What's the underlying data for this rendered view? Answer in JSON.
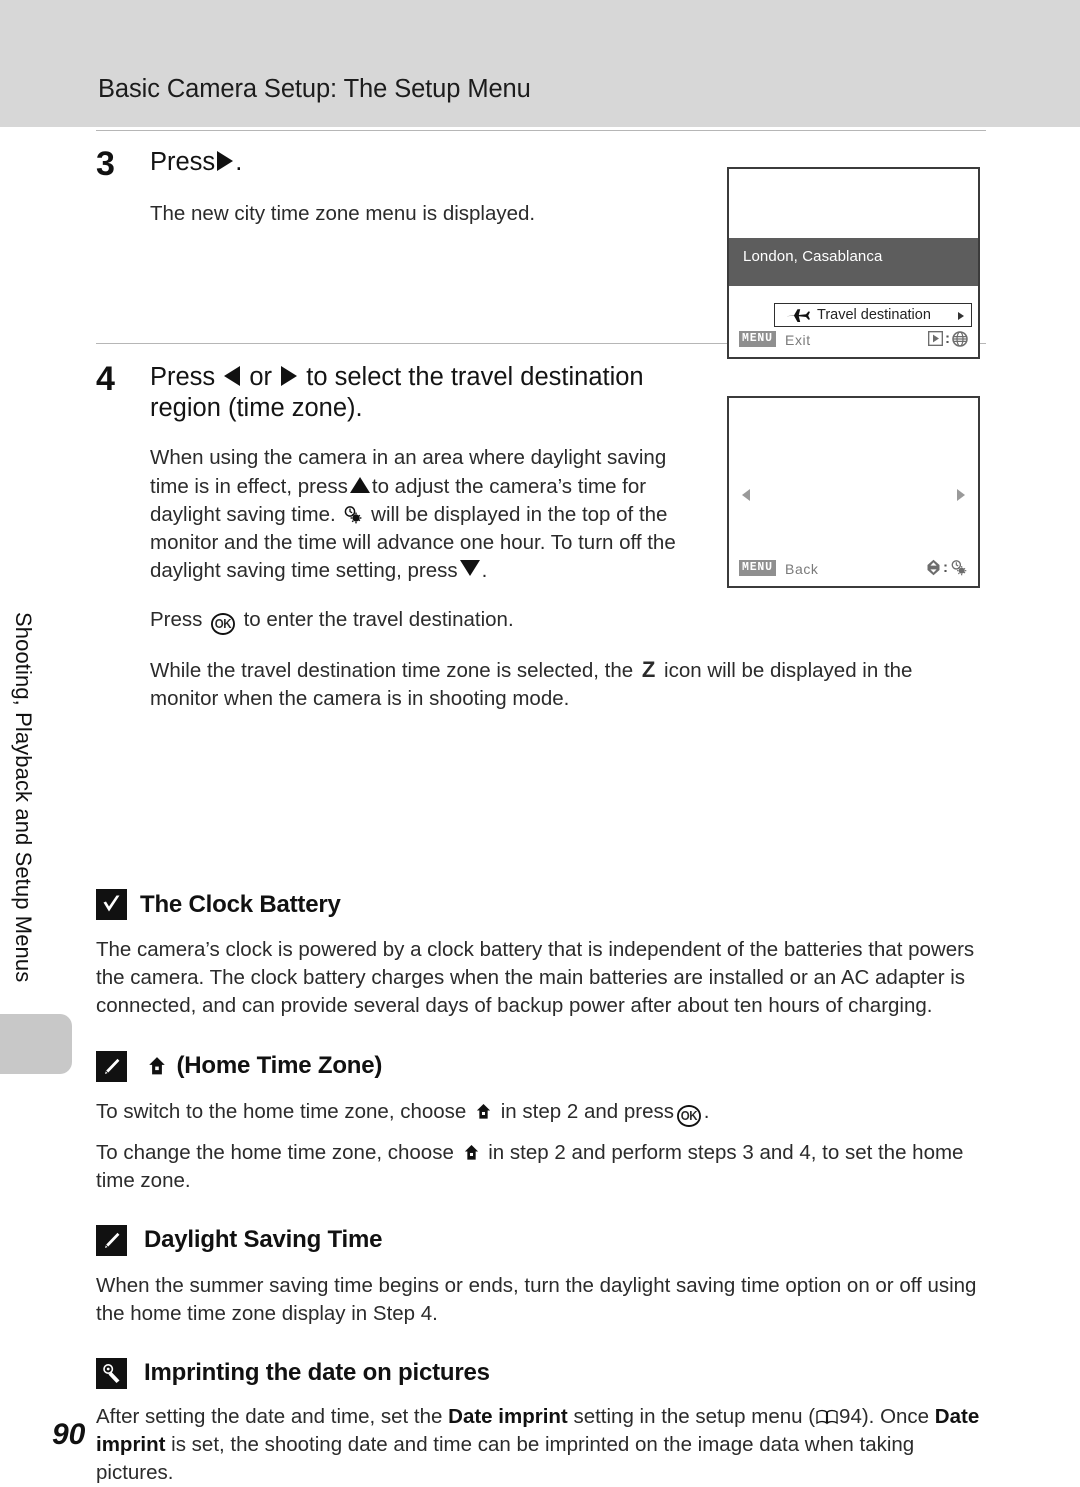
{
  "header": {
    "title": "Basic Camera Setup: The Setup Menu"
  },
  "sidebar": {
    "chapter_label": "Shooting, Playback and Setup Menus"
  },
  "page_number": "90",
  "steps": [
    {
      "number": "3",
      "heading_prefix": "Press",
      "heading_suffix": ".",
      "body": "The new city time zone menu is displayed."
    },
    {
      "number": "4",
      "heading_a": "Press",
      "heading_b": "or",
      "heading_c": "to select the travel destination region (time zone).",
      "p1_a": "When using the camera in an area where daylight saving time is in effect, press",
      "p1_b": "to adjust the camera’s time for daylight saving time.",
      "p1_c": "will be displayed in the top of the monitor and the time will advance one hour. To turn off the daylight saving time setting, press",
      "p1_d": ".",
      "p2_a": "Press",
      "p2_b": "to enter the travel destination.",
      "p3_a": "While the travel destination time zone is selected, the",
      "p3_z": "Z",
      "p3_b": "icon will be displayed in the monitor when the camera is in shooting mode."
    }
  ],
  "monitors": [
    {
      "id": "monitor-1",
      "city": "London, Casablanca",
      "row_label": "Travel destination",
      "menu_badge": "MENU",
      "menu_action": "Exit",
      "footer_icon_left": "playback-arrow-icon",
      "footer_icon_right": "globe-icon"
    },
    {
      "id": "monitor-2",
      "menu_badge": "MENU",
      "menu_action": "Back",
      "footer_icon_left": "up-down-arrow-icon",
      "footer_icon_right": "daylight-saving-icon"
    }
  ],
  "notes": [
    {
      "icon": "caution-checkbox-icon",
      "title": "The Clock Battery",
      "body": "The camera’s clock is powered by a clock battery that is independent of the batteries that powers the camera. The clock battery charges when the main batteries are installed or an AC adapter is connected, and can provide several days of backup power after about ten hours of charging."
    },
    {
      "icon": "pencil-note-icon",
      "title_suffix": "(Home Time Zone)",
      "line1_a": "To switch to the home time zone, choose",
      "line1_b": "in step 2 and press",
      "line1_c": ".",
      "line2_a": "To change the home time zone, choose",
      "line2_b": "in step 2 and perform steps 3 and 4, to set the home time zone."
    },
    {
      "icon": "pencil-note-icon",
      "title": "Daylight Saving Time",
      "body": "When the summer saving time begins or ends, turn the daylight saving time option on or off using the home time zone display in Step 4."
    },
    {
      "icon": "date-imprint-icon",
      "title": "Imprinting the date on pictures",
      "body_a": "After setting the date and time, set the",
      "bold_1": "Date imprint",
      "body_b": "setting in the setup menu (",
      "page_ref": "94",
      "body_c": "). Once",
      "bold_2": "Date imprint",
      "body_d": "is set, the shooting date and time can be imprinted on the image data when taking pictures."
    }
  ],
  "colors": {
    "header_band": "#d7d7d7",
    "monitor_border": "#3b3b3b",
    "city_band": "#5d5d5d",
    "menu_badge": "#8f8f8f",
    "side_tab": "#c8c8c8"
  }
}
